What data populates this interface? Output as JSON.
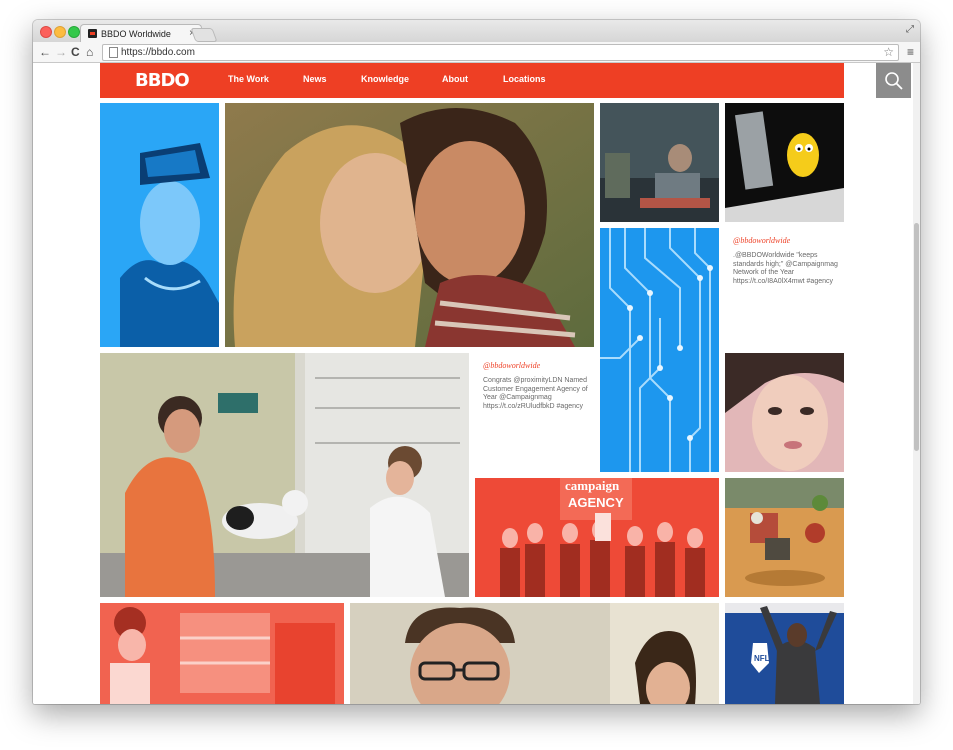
{
  "browser": {
    "tab_title": "BBDO Worldwide",
    "url": "https://bbdo.com",
    "back_glyph": "←",
    "forward_glyph": "→",
    "reload_glyph": "C",
    "home_glyph": "⌂",
    "star_glyph": "☆",
    "menu_glyph": "≡",
    "close_glyph": "×",
    "resize_glyph": "⤢"
  },
  "site": {
    "logo": "BBDO",
    "nav": [
      "The Work",
      "News",
      "Knowledge",
      "About",
      "Locations"
    ],
    "search_icon": "magnifier",
    "accent_color": "#ee3f24"
  },
  "tweets": [
    {
      "handle": "@bbdoworldwide",
      "text": ".@BBDOWorldwide \"keeps standards high;\" @Campaignmag Network of the Year https://t.co/I8A0lX4mwt #agency"
    },
    {
      "handle": "@bbdoworldwide",
      "text": "Congrats @proximityLDN Named Customer Engagement Agency of Year @Campaignmag https://t.co/zRUludfbkD #agency"
    }
  ],
  "media_text": {
    "campaign_cover": "campaign",
    "campaign_sub": "AGENCY",
    "nfl_logo": "NFL"
  }
}
